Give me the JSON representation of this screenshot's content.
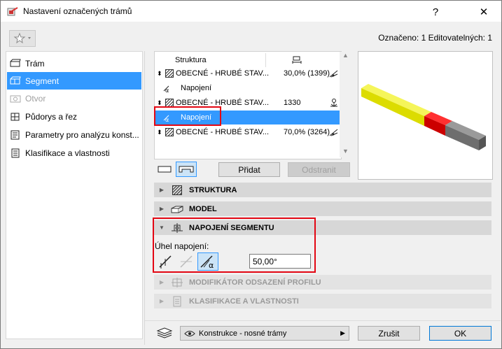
{
  "window": {
    "title": "Nastavení označených trámů",
    "help": "?",
    "close": "✕"
  },
  "header": {
    "selection_info": "Označeno: 1 Editovatelných: 1"
  },
  "sidebar": {
    "items": [
      {
        "label": "Trám",
        "icon": "beam-icon",
        "state": "normal"
      },
      {
        "label": "Segment",
        "icon": "segment-icon",
        "state": "selected"
      },
      {
        "label": "Otvor",
        "icon": "opening-icon",
        "state": "disabled"
      },
      {
        "label": "Půdorys a řez",
        "icon": "floorplan-section-icon",
        "state": "normal"
      },
      {
        "label": "Parametry pro analýzu konst...",
        "icon": "analysis-params-icon",
        "state": "normal"
      },
      {
        "label": "Klasifikace a vlastnosti",
        "icon": "classification-icon",
        "state": "normal"
      }
    ]
  },
  "tree": {
    "header": "Struktura",
    "rows": [
      {
        "label": "OBECNÉ - HRUBÉ STAV...",
        "value": "30,0% (1399)",
        "kind": "segment"
      },
      {
        "label": "Napojení",
        "value": "",
        "kind": "joint"
      },
      {
        "label": "OBECNÉ - HRUBÉ STAV...",
        "value": "1330",
        "kind": "segment"
      },
      {
        "label": "Napojení",
        "value": "",
        "kind": "joint",
        "selected": true
      },
      {
        "label": "OBECNÉ - HRUBÉ STAV...",
        "value": "70,0% (3264)",
        "kind": "segment"
      }
    ]
  },
  "buttons": {
    "add": "Přidat",
    "remove": "Odstranit",
    "cancel": "Zrušit",
    "ok": "OK"
  },
  "sections": {
    "structure": "STRUKTURA",
    "model": "MODEL",
    "joint": "NAPOJENÍ SEGMENTU",
    "profile_offset": "MODIFIKÁTOR ODSAZENÍ PROFILU",
    "classification": "KLASIFIKACE A VLASTNOSTI"
  },
  "joint_panel": {
    "angle_label": "Úhel napojení:",
    "angle_value": "50,00°"
  },
  "footer": {
    "layer_combo": "Konstrukce - nosné trámy"
  },
  "colors": {
    "selection": "#3399ff",
    "highlight_box": "#e30613",
    "beam_segment_1": "#e6e600",
    "beam_segment_2": "#e00000",
    "beam_segment_3": "#808080"
  }
}
